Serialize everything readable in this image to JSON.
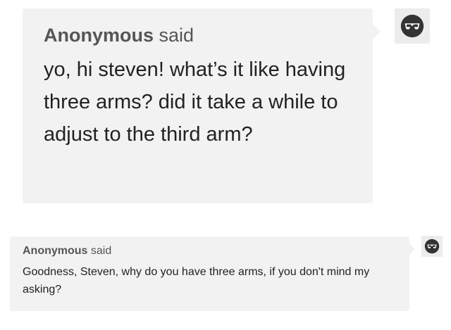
{
  "asks": [
    {
      "asker_name": "Anonymous",
      "asker_suffix": "said",
      "question": "yo, hi steven! what’s it like having three arms? did it take a while to adjust to the third arm?",
      "avatar_icon": "anonymous-sunglasses-icon"
    },
    {
      "asker_name": "Anonymous",
      "asker_suffix": "said",
      "question": "Goodness, Steven, why do you have three arms, if you don't mind my asking?",
      "avatar_icon": "anonymous-sunglasses-icon"
    }
  ],
  "colors": {
    "bubble": "#f2f2f2",
    "asker_text": "#555555",
    "question_text": "#222222",
    "avatar_bg": "#ececec",
    "avatar_fg": "#333333"
  }
}
